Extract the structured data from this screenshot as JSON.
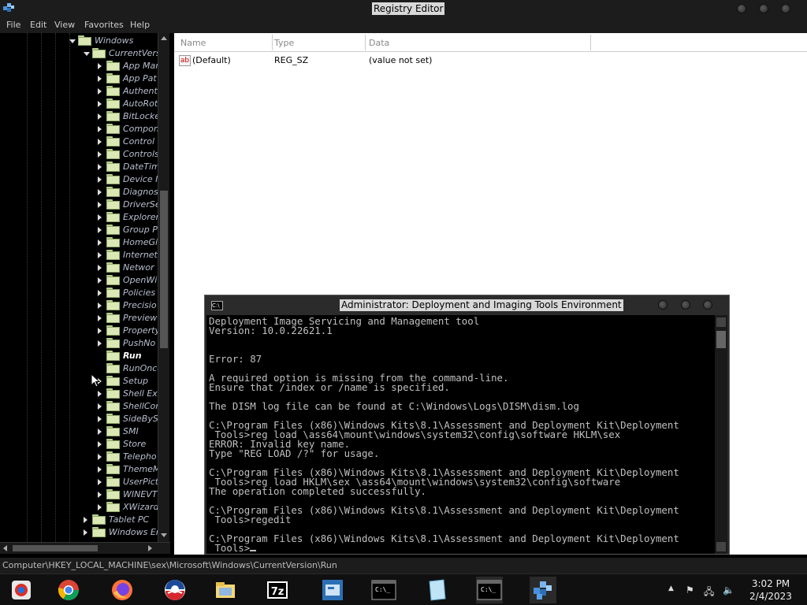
{
  "regedit": {
    "title": "Registry Editor",
    "menu": [
      "File",
      "Edit",
      "View",
      "Favorites",
      "Help"
    ],
    "tree": [
      {
        "label": "Windows",
        "indent": 0,
        "expanded": true
      },
      {
        "label": "CurrentVers",
        "indent": 1,
        "expanded": true
      },
      {
        "label": "App Mar",
        "indent": 2
      },
      {
        "label": "App Pat",
        "indent": 2
      },
      {
        "label": "Authent",
        "indent": 2
      },
      {
        "label": "AutoRot",
        "indent": 2
      },
      {
        "label": "BitLocke",
        "indent": 2
      },
      {
        "label": "Compon",
        "indent": 2
      },
      {
        "label": "Control",
        "indent": 2
      },
      {
        "label": "Controls",
        "indent": 2
      },
      {
        "label": "DateTim",
        "indent": 2
      },
      {
        "label": "Device I",
        "indent": 2
      },
      {
        "label": "Diagnos",
        "indent": 2
      },
      {
        "label": "DriverSe",
        "indent": 2
      },
      {
        "label": "Explorer",
        "indent": 2
      },
      {
        "label": "Group P",
        "indent": 2
      },
      {
        "label": "HomeGi",
        "indent": 2
      },
      {
        "label": "Internet",
        "indent": 2
      },
      {
        "label": "Networ",
        "indent": 2
      },
      {
        "label": "OpenWi",
        "indent": 2
      },
      {
        "label": "Policies",
        "indent": 2
      },
      {
        "label": "Precisio",
        "indent": 2
      },
      {
        "label": "Preview",
        "indent": 2
      },
      {
        "label": "Property",
        "indent": 2
      },
      {
        "label": "PushNo",
        "indent": 2
      },
      {
        "label": "Run",
        "indent": 2,
        "selected": true,
        "leaf": true
      },
      {
        "label": "RunOnce",
        "indent": 2,
        "leaf": true
      },
      {
        "label": "Setup",
        "indent": 2
      },
      {
        "label": "Shell Ex",
        "indent": 2
      },
      {
        "label": "ShellCor",
        "indent": 2
      },
      {
        "label": "SideByS",
        "indent": 2
      },
      {
        "label": "SMI",
        "indent": 2
      },
      {
        "label": "Store",
        "indent": 2
      },
      {
        "label": "Telepho",
        "indent": 2
      },
      {
        "label": "ThemeM",
        "indent": 2
      },
      {
        "label": "UserPict",
        "indent": 2
      },
      {
        "label": "WINEVT",
        "indent": 2
      },
      {
        "label": "XWizard",
        "indent": 2
      },
      {
        "label": "Tablet PC",
        "indent": 1
      },
      {
        "label": "Windows En",
        "indent": 1
      }
    ],
    "values": {
      "headers": {
        "name": "Name",
        "type": "Type",
        "data": "Data"
      },
      "rows": [
        {
          "name": "(Default)",
          "type": "REG_SZ",
          "data": "(value not set)",
          "icon_text": "ab"
        }
      ]
    },
    "status_path": "Computer\\HKEY_LOCAL_MACHINE\\sex\\Microsoft\\Windows\\CurrentVersion\\Run"
  },
  "cmd": {
    "title": "Administrator: Deployment and Imaging Tools Environment",
    "icon_text": "C:\\",
    "lines": [
      "Deployment Image Servicing and Management tool",
      "Version: 10.0.22621.1",
      "",
      "",
      "Error: 87",
      "",
      "A required option is missing from the command-line.",
      "Ensure that /index or /name is specified.",
      "",
      "The DISM log file can be found at C:\\Windows\\Logs\\DISM\\dism.log",
      "",
      "C:\\Program Files (x86)\\Windows Kits\\8.1\\Assessment and Deployment Kit\\Deployment",
      " Tools>reg load \\ass64\\mount\\windows\\system32\\config\\software HKLM\\sex",
      "ERROR: Invalid key name.",
      "Type \"REG LOAD /?\" for usage.",
      "",
      "C:\\Program Files (x86)\\Windows Kits\\8.1\\Assessment and Deployment Kit\\Deployment",
      " Tools>reg load HKLM\\sex \\ass64\\mount\\windows\\system32\\config\\software",
      "The operation completed successfully.",
      "",
      "C:\\Program Files (x86)\\Windows Kits\\8.1\\Assessment and Deployment Kit\\Deployment",
      " Tools>regedit",
      "",
      "C:\\Program Files (x86)\\Windows Kits\\8.1\\Assessment and Deployment Kit\\Deployment",
      " Tools>"
    ]
  },
  "taskbar": {
    "apps": [
      {
        "name": "app-store-icon"
      },
      {
        "name": "chrome-icon"
      },
      {
        "name": "firefox-icon"
      },
      {
        "name": "obama-logo-icon"
      },
      {
        "name": "file-explorer-icon"
      },
      {
        "name": "7zip-icon",
        "text": "7z"
      },
      {
        "name": "server-manager-icon"
      },
      {
        "name": "cmd-icon"
      },
      {
        "name": "notepad-icon"
      },
      {
        "name": "cmd-icon-active"
      },
      {
        "name": "regedit-icon"
      }
    ],
    "clock_time": "3:02 PM",
    "clock_date": "2/4/2023"
  },
  "colors": {
    "accent_blue": "#1a6fd1",
    "folder": "#dbe8b5",
    "console_text": "#c0c0c0"
  }
}
